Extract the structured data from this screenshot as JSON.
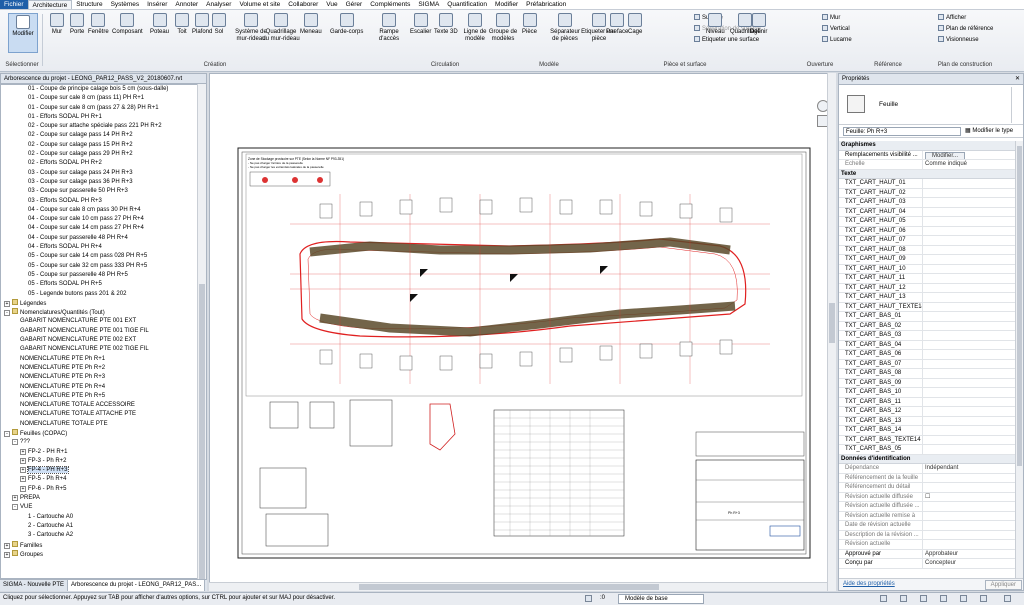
{
  "menu": [
    "Fichier",
    "Architecture",
    "Structure",
    "Systèmes",
    "Insérer",
    "Annoter",
    "Analyser",
    "Volume et site",
    "Collaborer",
    "Vue",
    "Gérer",
    "Compléments",
    "SIGMA",
    "Quantification",
    "Modifier",
    "Préfabrication"
  ],
  "ribbon": {
    "select_label": "Sélectionner",
    "modify": "Modifier",
    "big_buttons": [
      "Mur",
      "Porte",
      "Fenêtre",
      "Composant",
      "Poteau",
      "Toit",
      "Plafond",
      "Sol",
      "Système de mur-rideau",
      "Quadrillage du mur-rideau",
      "Meneau",
      "Garde-corps",
      "Rampe d'accès",
      "Escalier",
      "Texte 3D",
      "Ligne de modèle",
      "Groupe de modèles",
      "Pièce",
      "Séparateur de pièces",
      "Etiqueter une pièce",
      "Par face",
      "Cage",
      "Niveau",
      "Quadrillage",
      "Définir"
    ],
    "small_surface": [
      "Surface",
      "Séparation de surface",
      "Etiqueter une surface"
    ],
    "small_open": [
      "Mur",
      "Vertical",
      "Lucarne"
    ],
    "small_ref": [
      "Afficher",
      "Plan de référence",
      "Visionneuse"
    ],
    "panels": [
      "Création",
      "Circulation",
      "Modèle",
      "Pièce et surface",
      "Ouverture",
      "Référence",
      "Plan de construction"
    ]
  },
  "browser": {
    "title": "Arborescence du projet - LEONG_PAR12_PASS_V2_20180607.rvt",
    "items": [
      {
        "indent": 3,
        "text": "01 - Coupe de principe calage bois 5 cm (sous-dalle)"
      },
      {
        "indent": 3,
        "text": "01 - Coupe sur cale 8 cm (pass 11) PH R+1"
      },
      {
        "indent": 3,
        "text": "01 - Coupe sur cale 8 cm (pass 27 & 28) PH R+1"
      },
      {
        "indent": 3,
        "text": "01 - Efforts SODAL PH R+1"
      },
      {
        "indent": 3,
        "text": "02 - Coupe sur attache spéciale pass 221 PH R+2"
      },
      {
        "indent": 3,
        "text": "02 - Coupe sur calage pass 14 PH R+2"
      },
      {
        "indent": 3,
        "text": "02 - Coupe sur calage pass 15 PH R+2"
      },
      {
        "indent": 3,
        "text": "02 - Coupe sur calage pass 29 PH R+2"
      },
      {
        "indent": 3,
        "text": "02 - Efforts SODAL PH R+2"
      },
      {
        "indent": 3,
        "text": "03 - Coupe sur calage pass 24 PH R+3"
      },
      {
        "indent": 3,
        "text": "03 - Coupe sur calage pass 36 PH R+3"
      },
      {
        "indent": 3,
        "text": "03 - Coupe sur passerelle 50 PH R+3"
      },
      {
        "indent": 3,
        "text": "03 - Efforts SODAL PH R+3"
      },
      {
        "indent": 3,
        "text": "04 - Coupe sur cale 8 cm pass 30 PH R+4"
      },
      {
        "indent": 3,
        "text": "04 - Coupe sur cale 10 cm pass 27 PH R+4"
      },
      {
        "indent": 3,
        "text": "04 - Coupe sur cale 14 cm pass 27 PH R+4"
      },
      {
        "indent": 3,
        "text": "04 - Coupe sur passerelle 48 PH R+4"
      },
      {
        "indent": 3,
        "text": "04 - Efforts SODAL PH R+4"
      },
      {
        "indent": 3,
        "text": "05 - Coupe sur cale 14 cm pass 028 PH R+5"
      },
      {
        "indent": 3,
        "text": "05 - Coupe sur cale 32 cm pass 333 PH R+5"
      },
      {
        "indent": 3,
        "text": "05 - Coupe sur passerelle 48 PH R+5"
      },
      {
        "indent": 3,
        "text": "05 - Efforts SODAL PH R+5"
      },
      {
        "indent": 3,
        "text": "05 - Legende butons pass 201 & 202"
      },
      {
        "indent": 0,
        "text": "Légendes",
        "exp": "+"
      },
      {
        "indent": 0,
        "text": "Nomenclatures/Quantités (Tout)",
        "exp": "-"
      },
      {
        "indent": 2,
        "text": "GABARIT NOMENCLATURE PTE 001 EXT"
      },
      {
        "indent": 2,
        "text": "GABARIT NOMENCLATURE PTE 001 TIGE FIL"
      },
      {
        "indent": 2,
        "text": "GABARIT NOMENCLATURE PTE 002 EXT"
      },
      {
        "indent": 2,
        "text": "GABARIT NOMENCLATURE PTE 002 TIGE FIL"
      },
      {
        "indent": 2,
        "text": "NOMENCLATURE PTE Ph R+1"
      },
      {
        "indent": 2,
        "text": "NOMENCLATURE PTE Ph R+2"
      },
      {
        "indent": 2,
        "text": "NOMENCLATURE PTE Ph R+3"
      },
      {
        "indent": 2,
        "text": "NOMENCLATURE PTE Ph R+4"
      },
      {
        "indent": 2,
        "text": "NOMENCLATURE PTE Ph R+5"
      },
      {
        "indent": 2,
        "text": "NOMENCLATURE TOTALE ACCESSOIRE"
      },
      {
        "indent": 2,
        "text": "NOMENCLATURE TOTALE ATTACHE PTE"
      },
      {
        "indent": 2,
        "text": "NOMENCLATURE TOTALE PTE"
      },
      {
        "indent": 0,
        "text": "Feuilles (COPAC)",
        "exp": "-"
      },
      {
        "indent": 1,
        "text": "???",
        "exp": "-"
      },
      {
        "indent": 2,
        "text": "FP-2 - PH R+1",
        "exp": "+"
      },
      {
        "indent": 2,
        "text": "FP-3 - Ph R+2",
        "exp": "+"
      },
      {
        "indent": 2,
        "text": "FP-4 - PH R+3",
        "exp": "+",
        "sel": true
      },
      {
        "indent": 2,
        "text": "FP-5 - Ph R+4",
        "exp": "+"
      },
      {
        "indent": 2,
        "text": "FP-6 - Ph R+5",
        "exp": "+"
      },
      {
        "indent": 1,
        "text": "PREPA",
        "exp": "+"
      },
      {
        "indent": 1,
        "text": "VUE",
        "exp": "-"
      },
      {
        "indent": 3,
        "text": "1 - Cartouche A0"
      },
      {
        "indent": 3,
        "text": "2 - Cartouche A1"
      },
      {
        "indent": 3,
        "text": "3 - Cartouche A2"
      },
      {
        "indent": 0,
        "text": "Familles",
        "exp": "+"
      },
      {
        "indent": 0,
        "text": "Groupes",
        "exp": "+"
      }
    ],
    "tabs": [
      "SIGMA - Nouvelle PTE",
      "Arborescence du projet - LEONG_PAR12_PAS..."
    ]
  },
  "drawing": {
    "title_lines": [
      "Zone de Stockage provisoire sur PTE (Selon la Norme NF P93-351)",
      "- Ne pas charger l'arrière de la passerelle",
      "- Ne pas charger les extrémités latérales de la passerelle"
    ],
    "sheet_label": "Ph R+3"
  },
  "properties": {
    "title": "Propriétés",
    "type_name": "Feuille",
    "selector": "Feuille: Ph R+3",
    "modify_type": "Modifier le type",
    "categories": [
      {
        "name": "Graphismes",
        "rows": [
          {
            "n": "Remplacements visibilité ...",
            "v": "Modifier...",
            "btn": true
          },
          {
            "n": "Echelle",
            "v": "Comme indiqué",
            "gray": true
          }
        ]
      },
      {
        "name": "Texte",
        "rows": [
          {
            "n": "TXT_CART_HAUT_01",
            "v": ""
          },
          {
            "n": "TXT_CART_HAUT_02",
            "v": ""
          },
          {
            "n": "TXT_CART_HAUT_03",
            "v": ""
          },
          {
            "n": "TXT_CART_HAUT_04",
            "v": ""
          },
          {
            "n": "TXT_CART_HAUT_05",
            "v": ""
          },
          {
            "n": "TXT_CART_HAUT_06",
            "v": ""
          },
          {
            "n": "TXT_CART_HAUT_07",
            "v": ""
          },
          {
            "n": "TXT_CART_HAUT_08",
            "v": ""
          },
          {
            "n": "TXT_CART_HAUT_09",
            "v": ""
          },
          {
            "n": "TXT_CART_HAUT_10",
            "v": ""
          },
          {
            "n": "TXT_CART_HAUT_11",
            "v": ""
          },
          {
            "n": "TXT_CART_HAUT_12",
            "v": ""
          },
          {
            "n": "TXT_CART_HAUT_13",
            "v": ""
          },
          {
            "n": "TXT_CART_HAUT_TEXTE14",
            "v": ""
          },
          {
            "n": "TXT_CART_BAS_01",
            "v": ""
          },
          {
            "n": "TXT_CART_BAS_02",
            "v": ""
          },
          {
            "n": "TXT_CART_BAS_03",
            "v": ""
          },
          {
            "n": "TXT_CART_BAS_04",
            "v": ""
          },
          {
            "n": "TXT_CART_BAS_06",
            "v": ""
          },
          {
            "n": "TXT_CART_BAS_07",
            "v": ""
          },
          {
            "n": "TXT_CART_BAS_08",
            "v": ""
          },
          {
            "n": "TXT_CART_BAS_09",
            "v": ""
          },
          {
            "n": "TXT_CART_BAS_10",
            "v": ""
          },
          {
            "n": "TXT_CART_BAS_11",
            "v": ""
          },
          {
            "n": "TXT_CART_BAS_12",
            "v": ""
          },
          {
            "n": "TXT_CART_BAS_13",
            "v": ""
          },
          {
            "n": "TXT_CART_BAS_14",
            "v": ""
          },
          {
            "n": "TXT_CART_BAS_TEXTE14",
            "v": ""
          },
          {
            "n": "TXT_CART_BAS_05",
            "v": ""
          }
        ]
      },
      {
        "name": "Données d'identification",
        "rows": [
          {
            "n": "Dépendance",
            "v": "Indépendant",
            "gray": true
          },
          {
            "n": "Référencement de la feuille",
            "v": "",
            "gray": true
          },
          {
            "n": "Référencement du détail",
            "v": "",
            "gray": true
          },
          {
            "n": "Révision actuelle diffusée",
            "v": "☐",
            "gray": true
          },
          {
            "n": "Révision actuelle diffusée ...",
            "v": "",
            "gray": true
          },
          {
            "n": "Révision actuelle remise à",
            "v": "",
            "gray": true
          },
          {
            "n": "Date de révision actuelle",
            "v": "",
            "gray": true
          },
          {
            "n": "Description de la révision ...",
            "v": "",
            "gray": true
          },
          {
            "n": "Révision actuelle",
            "v": "",
            "gray": true
          },
          {
            "n": "Approuvé par",
            "v": "Approbateur"
          },
          {
            "n": "Conçu par",
            "v": "Concepteur"
          }
        ]
      }
    ],
    "help": "Aide des propriétés",
    "apply": "Appliquer"
  },
  "status": {
    "text": "Cliquez pour sélectionner. Appuyez sur TAB pour afficher d'autres options, sur CTRL pour ajouter et sur MAJ pour désactiver.",
    "zoom": ":0",
    "model": "Modèle de base"
  }
}
